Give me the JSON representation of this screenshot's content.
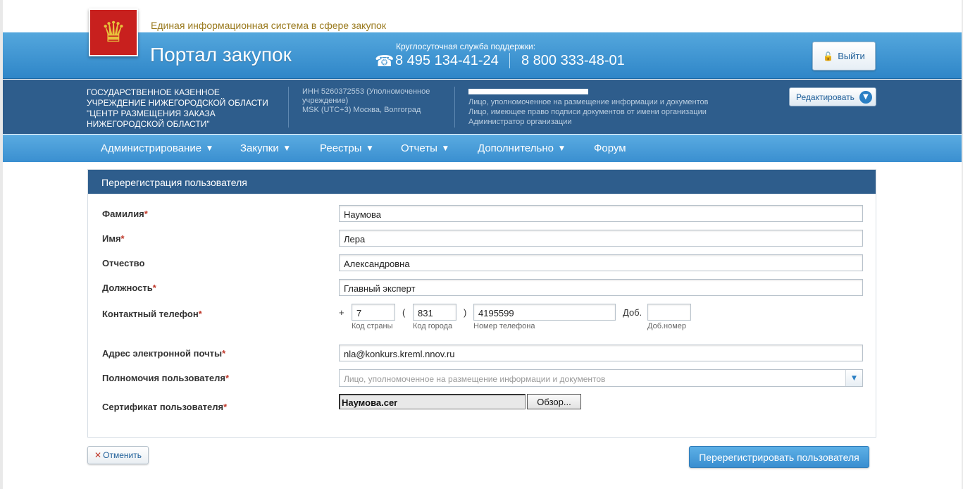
{
  "header": {
    "subtitle": "Единая информационная система в сфере закупок",
    "portal_title": "Портал закупок",
    "support_label": "Круглосуточная служба поддержки:",
    "phone1": "8 495 134-41-24",
    "phone2": "8 800 333-48-01",
    "logout_label": "Выйти",
    "emblem_icon": "coat-of-arms",
    "phone_icon": "phone-icon",
    "lock_icon": "lock-icon"
  },
  "org": {
    "name": "ГОСУДАРСТВЕННОЕ КАЗЕННОЕ УЧРЕЖДЕНИЕ НИЖЕГОРОДСКОЙ ОБЛАСТИ \"ЦЕНТР РАЗМЕЩЕНИЯ ЗАКАЗА НИЖЕГОРОДСКОЙ ОБЛАСТИ\"",
    "inn": "ИНН 5260372553 (Уполномоченное учреждение)",
    "timezone": "MSK (UTC+3) Москва, Волгоград",
    "roles": [
      "Лицо, уполномоченное на размещение информации и документов",
      "Лицо, имеющее право подписи документов от имени организации",
      "Администратор организации"
    ],
    "edit_label": "Редактировать"
  },
  "nav": {
    "items": [
      {
        "label": "Администрирование",
        "dropdown": true
      },
      {
        "label": "Закупки",
        "dropdown": true
      },
      {
        "label": "Реестры",
        "dropdown": true
      },
      {
        "label": "Отчеты",
        "dropdown": true
      },
      {
        "label": "Дополнительно",
        "dropdown": true
      },
      {
        "label": "Форум",
        "dropdown": false
      }
    ]
  },
  "form": {
    "title": "Перерегистрация пользователя",
    "required_mark": "*",
    "lastname": {
      "label": "Фамилия",
      "value": "Наумова"
    },
    "firstname": {
      "label": "Имя",
      "value": "Лера"
    },
    "middlename": {
      "label": "Отчество",
      "value": "Александровна"
    },
    "position": {
      "label": "Должность",
      "value": "Главный эксперт"
    },
    "phone": {
      "label": "Контактный телефон",
      "plus": "+",
      "open_paren": "(",
      "close_paren": ")",
      "country_code": "7",
      "city_code": "831",
      "number": "4195599",
      "ext_label": "Доб.",
      "ext": "",
      "hint_country": "Код страны",
      "hint_city": "Код города",
      "hint_number": "Номер телефона",
      "hint_ext": "Доб.номер"
    },
    "email": {
      "label": "Адрес электронной почты",
      "value": "nla@konkurs.kreml.nnov.ru"
    },
    "permissions": {
      "label": "Полномочия пользователя",
      "placeholder": "Лицо, уполномоченное на размещение информации и документов"
    },
    "certificate": {
      "label": "Сертификат пользователя",
      "file": "Наумова.cer",
      "browse_label": "Обзор..."
    },
    "cancel_label": "Отменить",
    "submit_label": "Перерегистрировать пользователя"
  },
  "colors": {
    "header_blue": "#3a8fd0",
    "org_bar": "#2e5d8c",
    "required": "#c0392b",
    "subtitle_gold": "#9a7a1e"
  }
}
